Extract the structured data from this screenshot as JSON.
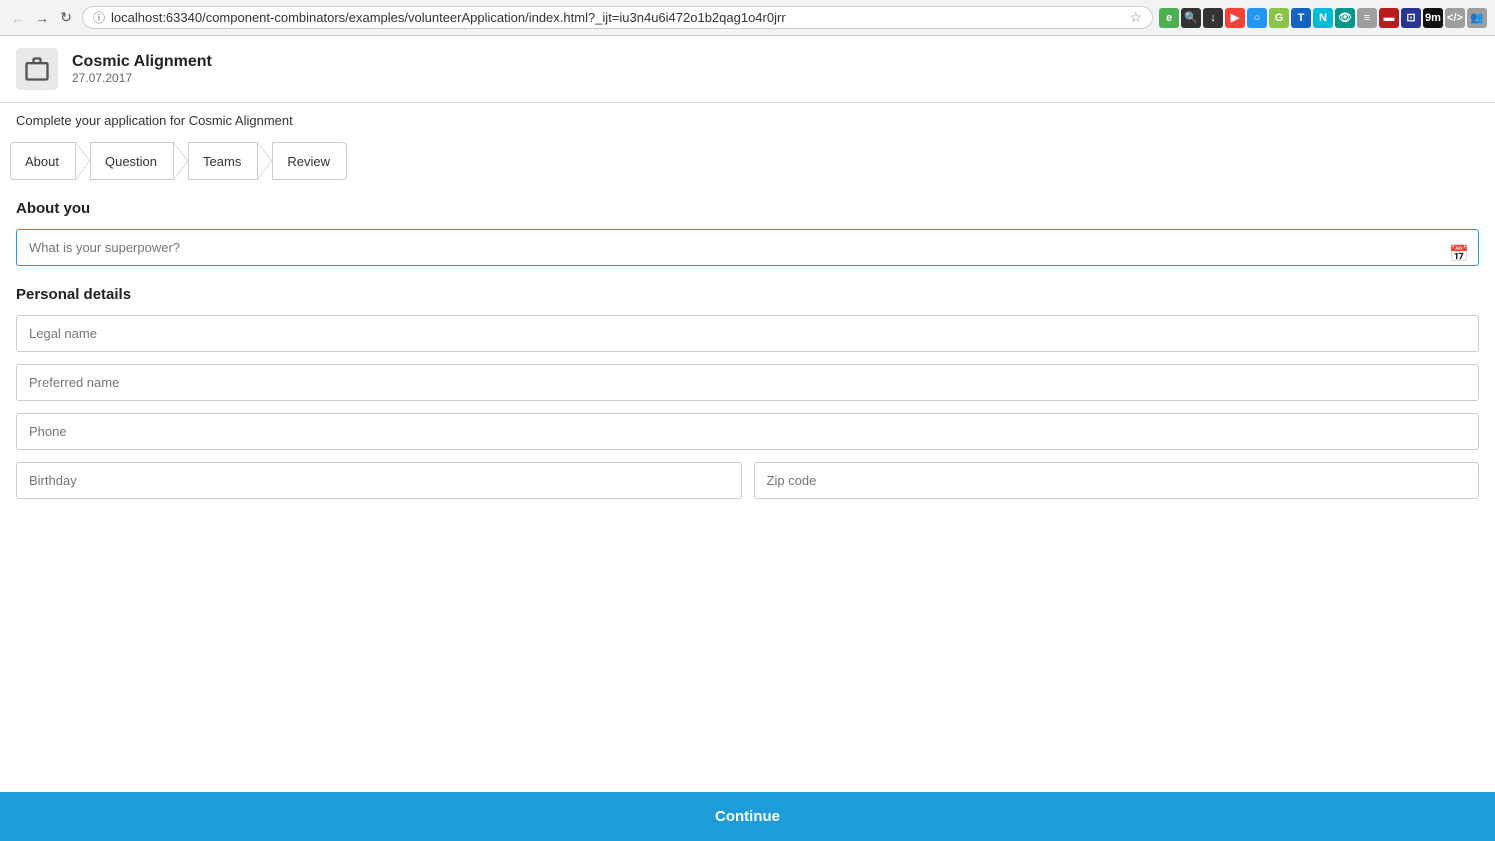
{
  "browser": {
    "url": "localhost:63340/component-combinators/examples/volunteerApplication/index.html?_ijt=iu3n4u6i472o1b2qag1o4r0jrr",
    "nav": {
      "back": "←",
      "forward": "→",
      "refresh": "↻"
    }
  },
  "app": {
    "logo_alt": "Cosmic Alignment logo",
    "title": "Cosmic Alignment",
    "date": "27.07.2017",
    "subtitle": "Complete your application for Cosmic Alignment"
  },
  "tabs": [
    {
      "id": "about",
      "label": "About",
      "active": true
    },
    {
      "id": "question",
      "label": "Question",
      "active": false
    },
    {
      "id": "teams",
      "label": "Teams",
      "active": false
    },
    {
      "id": "review",
      "label": "Review",
      "active": false
    }
  ],
  "about_you": {
    "section_title": "About you",
    "superpower_placeholder": "What is your superpower?"
  },
  "personal_details": {
    "section_title": "Personal details",
    "legal_name_placeholder": "Legal name",
    "preferred_name_placeholder": "Preferred name",
    "phone_placeholder": "Phone",
    "birthday_placeholder": "Birthday",
    "zip_code_placeholder": "Zip code"
  },
  "footer": {
    "continue_label": "Continue"
  }
}
